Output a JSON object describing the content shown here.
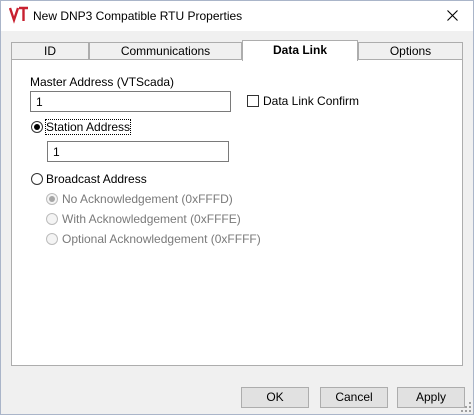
{
  "window": {
    "title": "New DNP3 Compatible RTU Properties",
    "icon_text": "VT"
  },
  "tabs": [
    {
      "label": "ID"
    },
    {
      "label": "Communications"
    },
    {
      "label": "Data Link",
      "active": true
    },
    {
      "label": "Options"
    }
  ],
  "form": {
    "master_address_label": "Master Address (VTScada)",
    "master_address_value": "1",
    "data_link_confirm_label": "Data Link Confirm",
    "data_link_confirm_checked": false,
    "station_address_label": "Station Address",
    "station_address_value": "1",
    "broadcast_address_label": "Broadcast Address",
    "broadcast_options": [
      {
        "label": "No Acknowledgement (0xFFFD)",
        "selected": true
      },
      {
        "label": "With Acknowledgement (0xFFFE)",
        "selected": false
      },
      {
        "label": "Optional Acknowledgement (0xFFFF)",
        "selected": false
      }
    ],
    "selected_address_mode": "Station Address"
  },
  "buttons": {
    "ok": "OK",
    "cancel": "Cancel",
    "apply": "Apply"
  },
  "colors": {
    "icon_red": "#c8202f",
    "window_bg": "#f0f0f0",
    "panel_bg": "#ffffff"
  }
}
